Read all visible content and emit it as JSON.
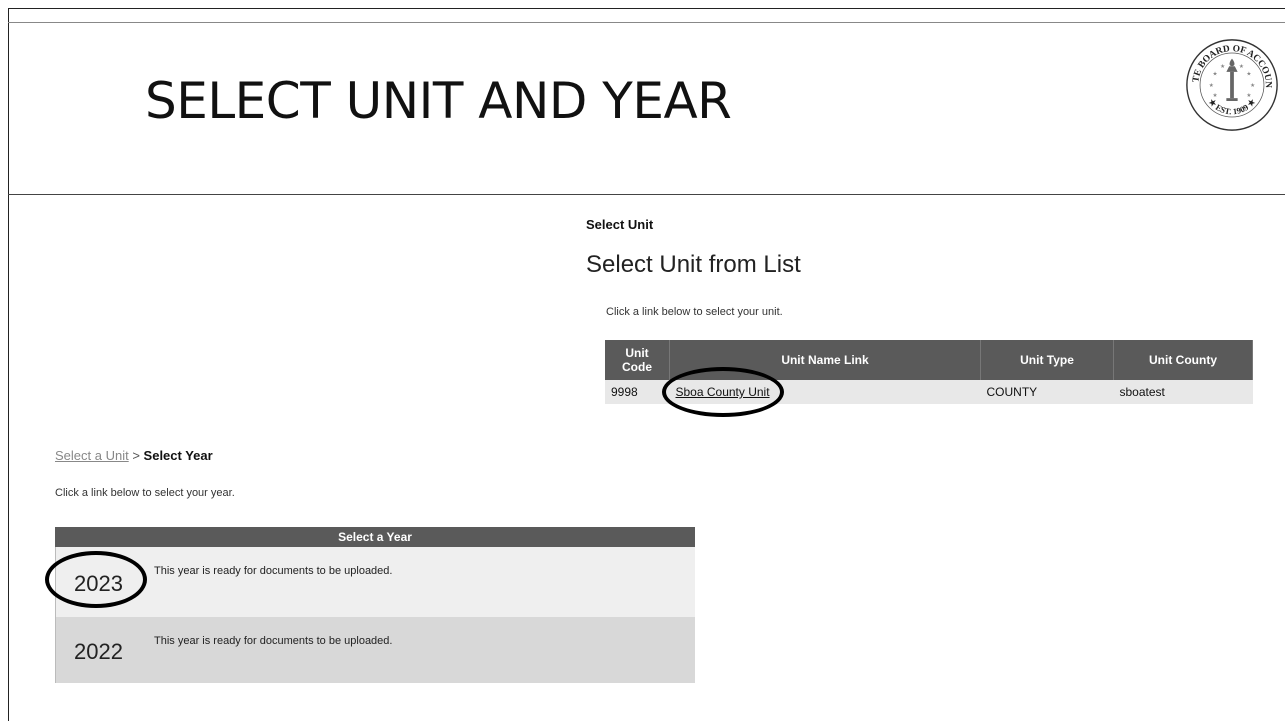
{
  "slide": {
    "title": "SELECT UNIT AND YEAR"
  },
  "seal": {
    "top_text": "STATE BOARD OF ACCOUNTS",
    "bottom_text": "EST. 1909"
  },
  "unit_section": {
    "top_label": "Select Unit",
    "heading": "Select Unit from List",
    "instruction": "Click a link below to select your unit.",
    "columns": [
      "Unit Code",
      "Unit Name Link",
      "Unit Type",
      "Unit County"
    ],
    "rows": [
      {
        "code": "9998",
        "name": "Sboa County Unit",
        "type": "COUNTY",
        "county": "sboatest"
      }
    ]
  },
  "year_section": {
    "breadcrumb": {
      "link": "Select a Unit",
      "separator": ">",
      "current": "Select Year"
    },
    "instruction": "Click a link below to select your year.",
    "header": "Select a Year",
    "rows": [
      {
        "year": "2023",
        "desc": "This year is ready for documents to be uploaded."
      },
      {
        "year": "2022",
        "desc": "This year is ready for documents to be uploaded."
      }
    ]
  }
}
